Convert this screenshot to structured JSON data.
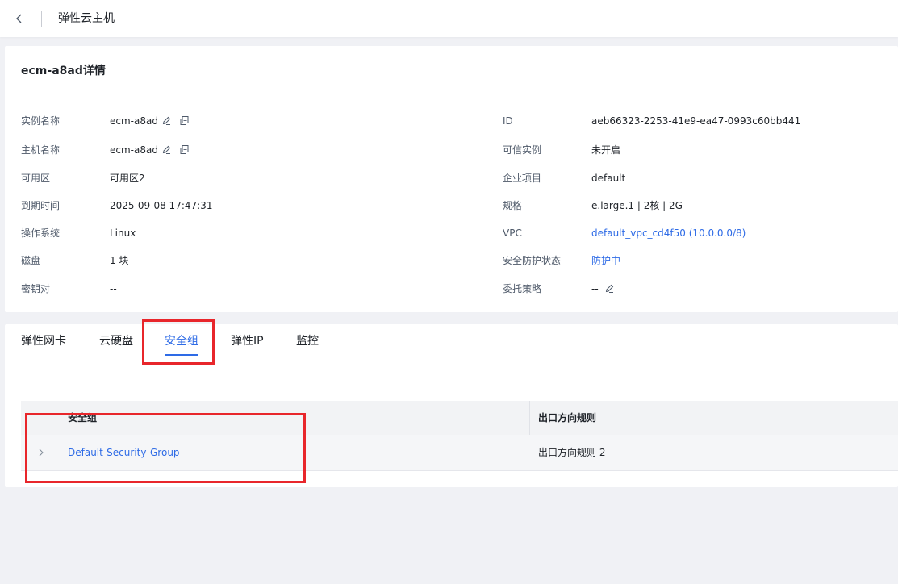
{
  "header": {
    "title": "弹性云主机"
  },
  "detail": {
    "title": "ecm-a8ad详情",
    "left": [
      {
        "label": "实例名称",
        "value": "ecm-a8ad",
        "editable": true,
        "copyable": true
      },
      {
        "label": "主机名称",
        "value": "ecm-a8ad",
        "editable": true,
        "copyable": true
      },
      {
        "label": "可用区",
        "value": "可用区2"
      },
      {
        "label": "到期时间",
        "value": "2025-09-08 17:47:31"
      },
      {
        "label": "操作系统",
        "value": "Linux"
      },
      {
        "label": "磁盘",
        "value": "1 块"
      },
      {
        "label": "密钥对",
        "value": "--"
      }
    ],
    "right": [
      {
        "label": "ID",
        "value": "aeb66323-2253-41e9-ea47-0993c60bb441"
      },
      {
        "label": "可信实例",
        "value": "未开启"
      },
      {
        "label": "企业项目",
        "value": "default"
      },
      {
        "label": "规格",
        "value": "e.large.1 | 2核 | 2G"
      },
      {
        "label": "VPC",
        "value": "default_vpc_cd4f50 (10.0.0.0/8)",
        "link": true
      },
      {
        "label": "安全防护状态",
        "value": "防护中",
        "link": true
      },
      {
        "label": "委托策略",
        "value": "--",
        "editable": true
      }
    ]
  },
  "tabs": [
    {
      "label": "弹性网卡",
      "active": false
    },
    {
      "label": "云硬盘",
      "active": false
    },
    {
      "label": "安全组",
      "active": true
    },
    {
      "label": "弹性IP",
      "active": false
    },
    {
      "label": "监控",
      "active": false
    }
  ],
  "table": {
    "columns": [
      "安全组",
      "出口方向规则"
    ],
    "rows": [
      {
        "name": "Default-Security-Group",
        "egress": "出口方向规则 2"
      }
    ]
  },
  "colors": {
    "accent": "#2e6be6",
    "highlight": "#e8262b",
    "background": "#f0f1f5"
  }
}
